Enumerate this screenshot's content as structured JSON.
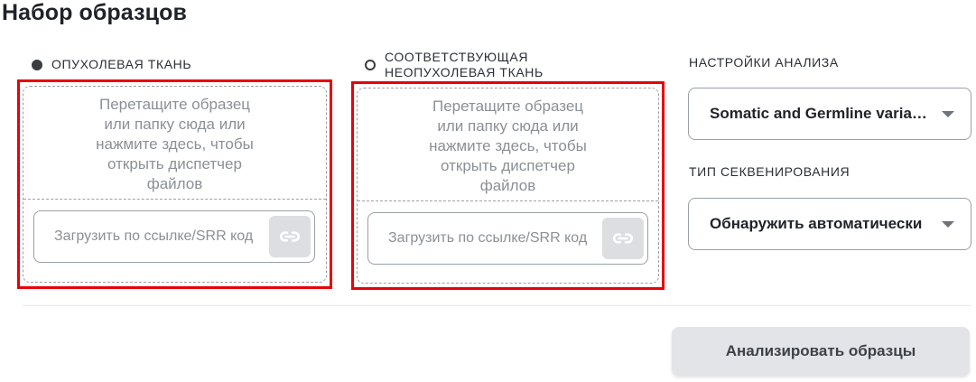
{
  "page_title": "Набор образцов",
  "tumor": {
    "label": "ОПУХОЛЕВАЯ ТКАНЬ",
    "drop_text_lines": [
      "Перетащите образец",
      "или папку сюда или",
      "нажмите здесь, чтобы",
      "открыть диспетчер",
      "файлов"
    ],
    "url_placeholder": "Загрузить по ссылке/SRR код"
  },
  "normal": {
    "label_line1": "СООТВЕТСТВУЮЩАЯ",
    "label_line2": "НЕОПУХОЛЕВАЯ ТКАНЬ",
    "drop_text_lines": [
      "Перетащите образец",
      "или папку сюда или",
      "нажмите здесь, чтобы",
      "открыть диспетчер",
      "файлов"
    ],
    "url_placeholder": "Загрузить по ссылке/SRR код"
  },
  "settings": {
    "analysis_label": "НАСТРОЙКИ АНАЛИЗА",
    "analysis_value": "Somatic and Germline variants",
    "sequencing_label": "ТИП СЕКВЕНИРОВАНИЯ",
    "sequencing_value": "Обнаружить автоматически"
  },
  "analyze_button": "Анализировать образцы",
  "icons": {
    "link": "link-icon",
    "caret": "chevron-down-icon",
    "radio_selected": "radio-selected-icon",
    "radio_empty": "radio-empty-icon"
  },
  "colors": {
    "highlight": "#e8000b",
    "button_bg": "#e2e4e8",
    "muted_text": "#8b9096"
  }
}
